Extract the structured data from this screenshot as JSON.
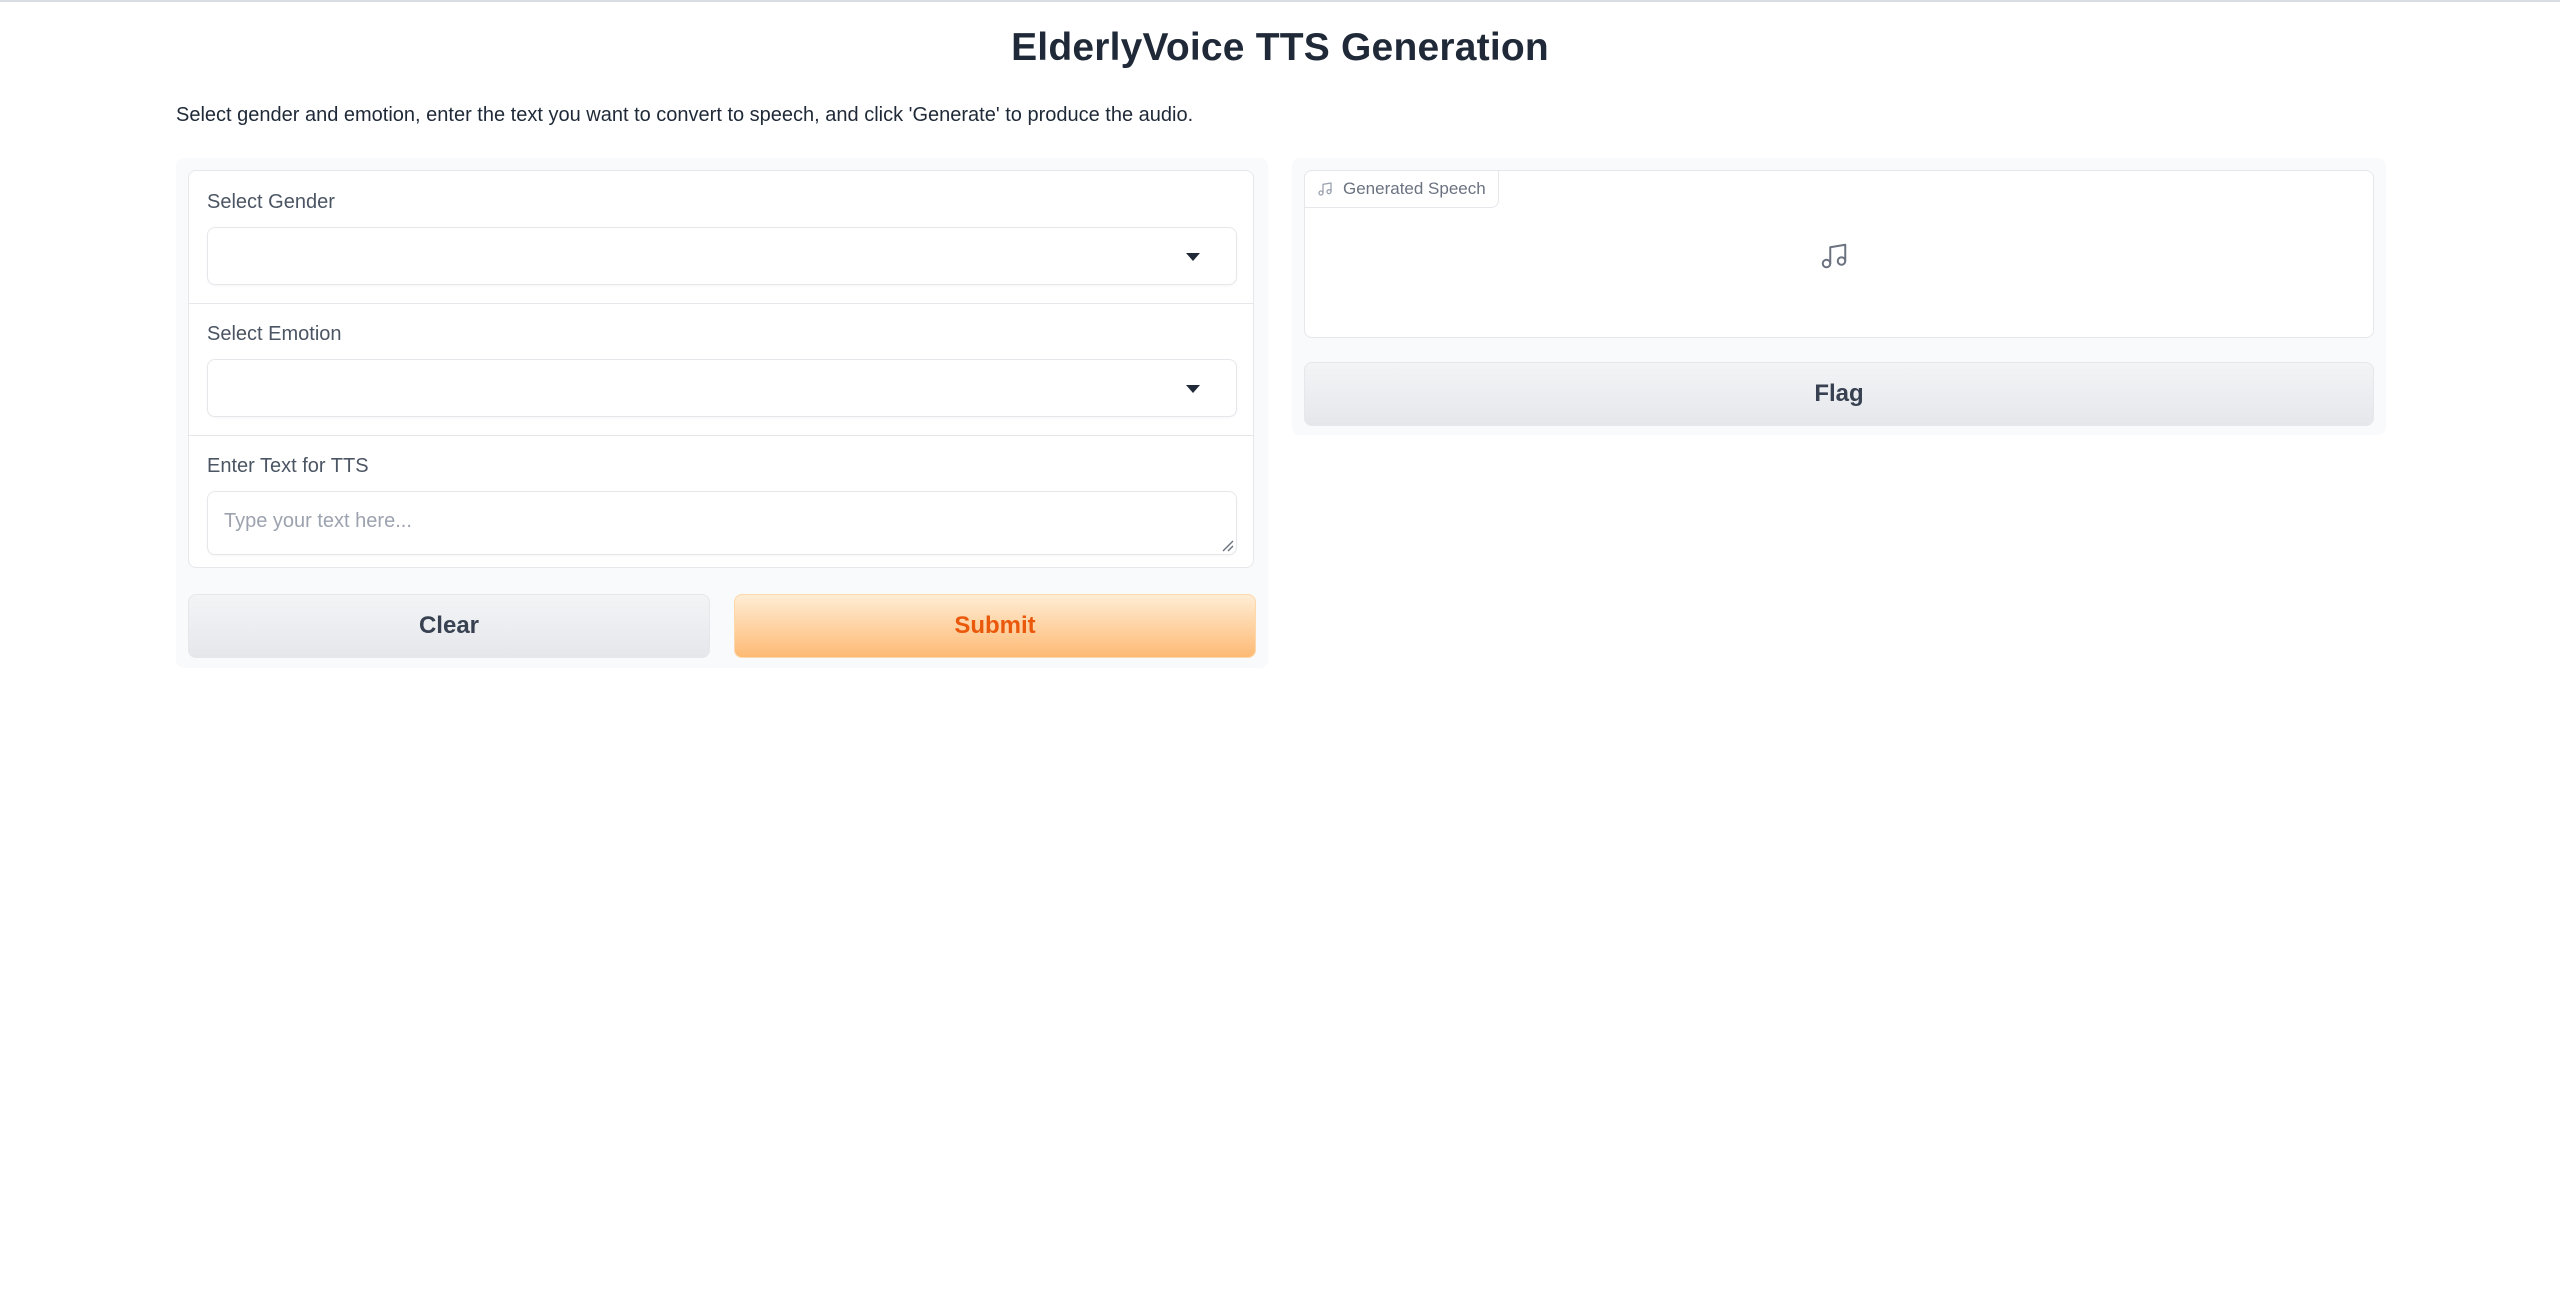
{
  "header": {
    "title": "ElderlyVoice TTS Generation",
    "description": "Select gender and emotion, enter the text you want to convert to speech, and click 'Generate' to produce the audio."
  },
  "form": {
    "gender": {
      "label": "Select Gender",
      "value": ""
    },
    "emotion": {
      "label": "Select Emotion",
      "value": ""
    },
    "text": {
      "label": "Enter Text for TTS",
      "placeholder": "Type your text here...",
      "value": ""
    }
  },
  "actions": {
    "clear_label": "Clear",
    "submit_label": "Submit"
  },
  "output": {
    "audio_label": "Generated Speech",
    "audio_icon": "music-note-icon",
    "flag_label": "Flag"
  },
  "colors": {
    "accent": "#ea580c",
    "submit_gradient_start": "#ffedd5",
    "submit_gradient_end": "#fdba74"
  }
}
